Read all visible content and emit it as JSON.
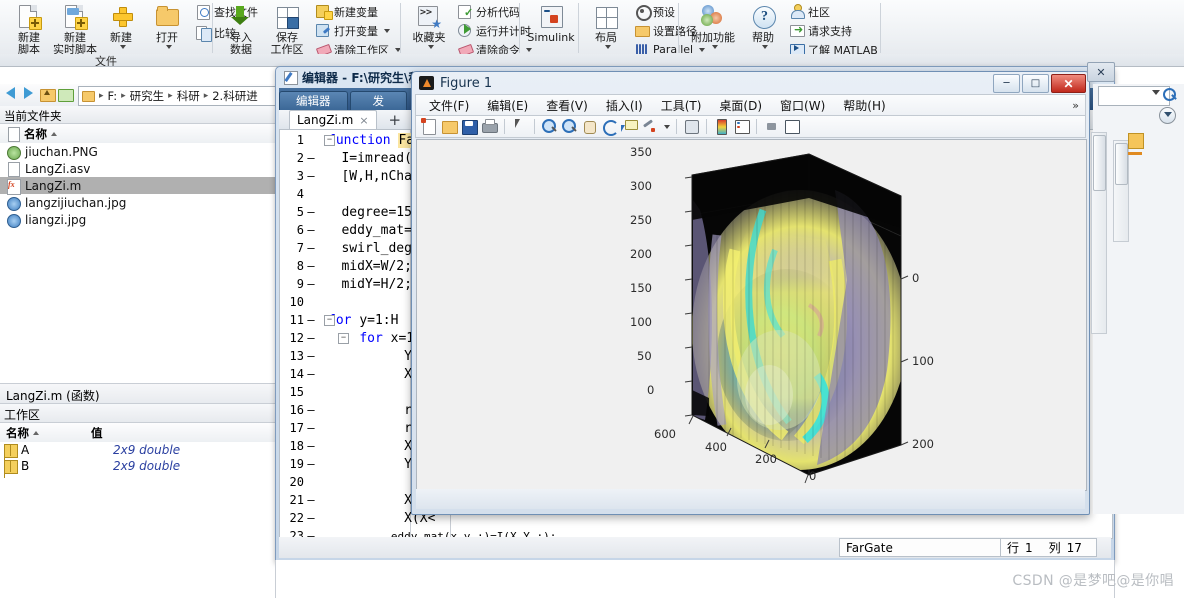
{
  "toolstrip": {
    "group_label": "文件",
    "items": [
      {
        "name": "new-script",
        "label": "新建\n脚本",
        "icon": "new-script-icon",
        "caret": false
      },
      {
        "name": "new-live-script",
        "label": "新建\n实时脚本",
        "icon": "new-live-script-icon",
        "caret": false
      },
      {
        "name": "new",
        "label": "新建",
        "icon": "plus-icon",
        "caret": true
      },
      {
        "name": "open",
        "label": "打开",
        "icon": "folder-icon",
        "caret": true
      },
      {
        "name": "import-data",
        "label": "导入\n数据",
        "icon": "import-data-icon",
        "caret": false
      },
      {
        "name": "save-workspace",
        "label": "保存\n工作区",
        "icon": "save-workspace-icon",
        "caret": false
      },
      {
        "name": "favorites",
        "label": "收藏夹",
        "icon": "favorites-icon",
        "caret": true
      },
      {
        "name": "simulink",
        "label": "Simulink",
        "icon": "simulink-icon",
        "caret": false
      },
      {
        "name": "layout",
        "label": "布局",
        "icon": "layout-icon",
        "caret": true
      },
      {
        "name": "add-ons",
        "label": "附加功能",
        "icon": "add-ons-icon",
        "caret": true
      },
      {
        "name": "help",
        "label": "帮助",
        "icon": "help-icon",
        "caret": true
      }
    ],
    "small_items": [
      {
        "name": "find-files",
        "label": "查找文件",
        "icon": "find-files-icon"
      },
      {
        "name": "compare",
        "label": "比较",
        "icon": "compare-icon"
      },
      {
        "name": "new-variable",
        "label": "新建变量",
        "icon": "new-variable-icon"
      },
      {
        "name": "open-variable",
        "label": "打开变量",
        "icon": "open-variable-icon",
        "caret": true
      },
      {
        "name": "clear-workspace",
        "label": "清除工作区",
        "icon": "clear-workspace-icon",
        "caret": true
      },
      {
        "name": "analyze-code",
        "label": "分析代码",
        "icon": "analyze-code-icon"
      },
      {
        "name": "run-and-time",
        "label": "运行并计时",
        "icon": "run-and-time-icon"
      },
      {
        "name": "clear-commands",
        "label": "清除命令",
        "icon": "clear-commands-icon",
        "caret": true
      },
      {
        "name": "preferences",
        "label": "预设",
        "icon": "preferences-icon"
      },
      {
        "name": "set-path",
        "label": "设置路径",
        "icon": "set-path-icon"
      },
      {
        "name": "parallel",
        "label": "Parallel",
        "icon": "parallel-icon",
        "caret": true
      },
      {
        "name": "community",
        "label": "社区",
        "icon": "community-icon"
      },
      {
        "name": "request-support",
        "label": "请求支持",
        "icon": "request-support-icon"
      },
      {
        "name": "learn-matlab",
        "label": "了解 MATLAB",
        "icon": "learn-matlab-icon"
      }
    ]
  },
  "address_bar": {
    "crumbs": [
      "F:",
      "研究生",
      "科研",
      "2.科研进"
    ],
    "back_icon": "back-arrow-icon",
    "forward_icon": "forward-arrow-icon",
    "up_icon": "up-folder-icon",
    "refresh_icon": "refresh-icon",
    "folder_icon": "folder-icon"
  },
  "current_folder": {
    "panel_title": "当前文件夹",
    "column_header": "名称",
    "files": [
      {
        "name": "jiuchan.PNG",
        "icon": "png-file-icon",
        "selected": false
      },
      {
        "name": "LangZi.asv",
        "icon": "blank-file-icon",
        "selected": false
      },
      {
        "name": "LangZi.m",
        "icon": "matlab-file-icon",
        "selected": true
      },
      {
        "name": "langzijiuchan.jpg",
        "icon": "jpg-file-icon",
        "selected": false
      },
      {
        "name": "liangzi.jpg",
        "icon": "jpg-file-icon",
        "selected": false
      }
    ],
    "details": "LangZi.m  (函数)"
  },
  "workspace": {
    "panel_title": "工作区",
    "columns": [
      "名称",
      "值"
    ],
    "rows": [
      {
        "name": "A",
        "value": "2x9 double"
      },
      {
        "name": "B",
        "value": "2x9 double"
      }
    ]
  },
  "editor_window": {
    "title": "编辑器 - F:\\研究生\\科研",
    "ribbon_tabs": [
      "编辑器",
      "发"
    ],
    "tab": {
      "label": "LangZi.m",
      "close": "×"
    },
    "add_tab": "+",
    "code_lines": [
      {
        "n": "1",
        "dash": false,
        "fold": "minus",
        "text": "function Far",
        "kw": "function",
        "hl": "Far"
      },
      {
        "n": "2",
        "dash": true,
        "fold": "",
        "text": "  I=imread('la",
        "str": "'la"
      },
      {
        "n": "3",
        "dash": true,
        "fold": "",
        "text": "  [W,H,nChanel"
      },
      {
        "n": "4",
        "dash": false,
        "fold": "",
        "text": ""
      },
      {
        "n": "5",
        "dash": true,
        "fold": "",
        "text": "  degree=15;"
      },
      {
        "n": "6",
        "dash": true,
        "fold": "",
        "text": "  eddy_mat=zer"
      },
      {
        "n": "7",
        "dash": true,
        "fold": "",
        "text": "  swirl_degree"
      },
      {
        "n": "8",
        "dash": true,
        "fold": "",
        "text": "  midX=W/2;"
      },
      {
        "n": "9",
        "dash": true,
        "fold": "",
        "text": "  midY=H/2;"
      },
      {
        "n": "10",
        "dash": false,
        "fold": "",
        "text": ""
      },
      {
        "n": "11",
        "dash": true,
        "fold": "minus",
        "text": "for y=1:H",
        "kw": "for"
      },
      {
        "n": "12",
        "dash": true,
        "fold": "minus",
        "text": "    for x=1:",
        "kw": "for"
      },
      {
        "n": "13",
        "dash": true,
        "fold": "",
        "text": "        Yoff"
      },
      {
        "n": "14",
        "dash": true,
        "fold": "",
        "text": "        Xoff"
      },
      {
        "n": "15",
        "dash": false,
        "fold": "",
        "text": ""
      },
      {
        "n": "16",
        "dash": true,
        "fold": "",
        "text": "        radi"
      },
      {
        "n": "17",
        "dash": true,
        "fold": "",
        "text": "        radi"
      },
      {
        "n": "18",
        "dash": true,
        "fold": "",
        "text": "        X=in"
      },
      {
        "n": "19",
        "dash": true,
        "fold": "",
        "text": "        Y=in"
      },
      {
        "n": "20",
        "dash": false,
        "fold": "",
        "text": ""
      },
      {
        "n": "21",
        "dash": true,
        "fold": "",
        "text": "        X(X>"
      },
      {
        "n": "22",
        "dash": true,
        "fold": "",
        "text": "        X(X<"
      },
      {
        "n": "23",
        "dash": true,
        "fold": "",
        "text": "        eddy_mat(x,y,:)=I(X,Y,:);"
      }
    ],
    "status": {
      "function_name": "FarGate",
      "row_label": "行",
      "row_value": "1",
      "col_label": "列",
      "col_value": "17"
    }
  },
  "figure_window": {
    "title": "Figure 1",
    "icon": "matlab-figure-icon",
    "window_buttons": {
      "minimize": "─",
      "maximize": "□",
      "close": "✕"
    },
    "menus": [
      "文件(F)",
      "编辑(E)",
      "查看(V)",
      "插入(I)",
      "工具(T)",
      "桌面(D)",
      "窗口(W)",
      "帮助(H)"
    ],
    "overflow": "»",
    "toolbar_icons": [
      "new-figure-icon",
      "open-file-icon",
      "save-figure-icon",
      "print-icon",
      "pointer-icon",
      "zoom-in-icon",
      "zoom-out-icon",
      "pan-icon",
      "rotate-3d-icon",
      "data-cursor-icon",
      "brush-icon",
      "link-plot-icon",
      "colorbar-icon",
      "legend-icon",
      "hide-plot-tools-icon",
      "show-plot-tools-icon"
    ]
  },
  "chart_data": {
    "type": "surface",
    "title": "",
    "xlabel": "",
    "ylabel": "",
    "zlabel": "",
    "background": "#000000",
    "grid": true,
    "legend": false,
    "colormap": [
      "#f2f06a",
      "#9fe6cf",
      "#35d7d0",
      "#b7a7d9",
      "#8f88b8",
      "#e8e7c0",
      "#5f5b86"
    ],
    "axes": {
      "x": {
        "ticks": [
          600,
          400,
          200,
          0
        ],
        "range": [
          0,
          640
        ],
        "position": "front-left"
      },
      "y": {
        "ticks": [
          0,
          100,
          200
        ],
        "range": [
          0,
          240
        ],
        "position": "right"
      },
      "z": {
        "ticks": [
          0,
          50,
          100,
          150,
          200,
          250,
          300,
          350
        ],
        "range": [
          0,
          360
        ],
        "position": "left"
      }
    },
    "description": "3D swirled image surface (eddy/vortex transform of a photo) rendered on black axes"
  },
  "right_dock": {
    "search_placeholder": "",
    "search_icon": "search-icon",
    "dropdown_icon": "chevron-down-icon",
    "collapse_icon": "collapse-icon"
  },
  "watermark": "CSDN @是梦吧@是你唱"
}
